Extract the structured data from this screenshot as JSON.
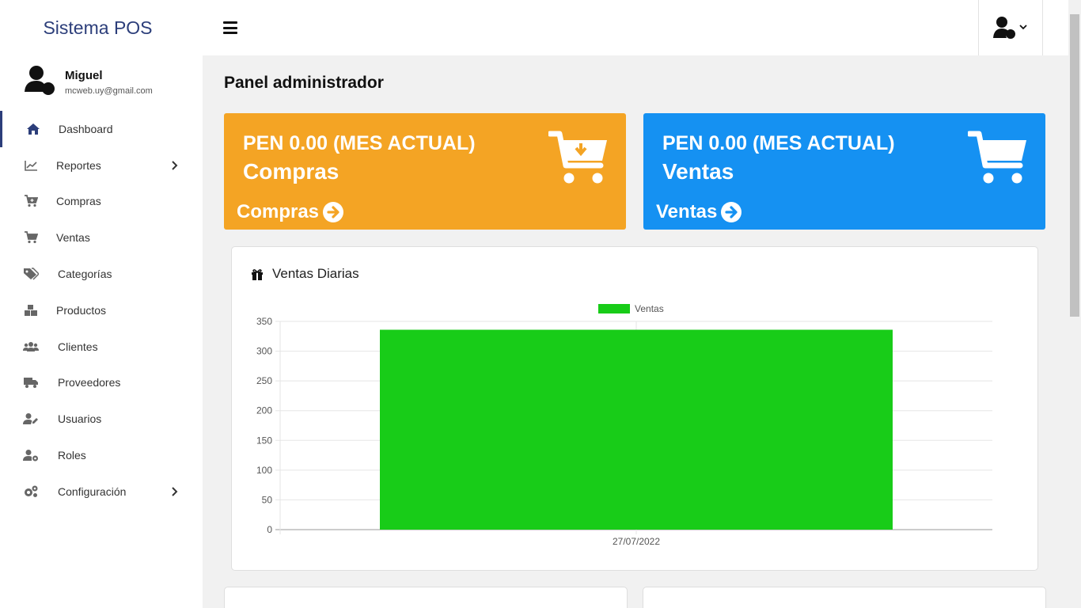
{
  "app": {
    "title": "Sistema POS"
  },
  "user": {
    "name": "Miguel",
    "email": "mcweb.uy@gmail.com"
  },
  "sidebar": {
    "items": [
      {
        "label": "Dashboard",
        "icon": "home-icon"
      },
      {
        "label": "Reportes",
        "icon": "chart-line-icon"
      },
      {
        "label": "Compras",
        "icon": "cart-plus-icon"
      },
      {
        "label": "Ventas",
        "icon": "cart-icon"
      },
      {
        "label": "Categorías",
        "icon": "tags-icon"
      },
      {
        "label": "Productos",
        "icon": "boxes-icon"
      },
      {
        "label": "Clientes",
        "icon": "users-icon"
      },
      {
        "label": "Proveedores",
        "icon": "truck-icon"
      },
      {
        "label": "Usuarios",
        "icon": "user-edit-icon"
      },
      {
        "label": "Roles",
        "icon": "user-cog-icon"
      },
      {
        "label": "Configuración",
        "icon": "cogs-icon"
      }
    ]
  },
  "main": {
    "page_title": "Panel administrador",
    "cards": [
      {
        "amount": "PEN 0.00 (MES ACTUAL)",
        "title": "Compras",
        "link": "Compras",
        "color": "#f4a424"
      },
      {
        "amount": "PEN 0.00 (MES ACTUAL)",
        "title": "Ventas",
        "link": "Ventas",
        "color": "#1591f2"
      }
    ],
    "chart_title": "Ventas Diarias"
  },
  "chart_data": {
    "type": "bar",
    "categories": [
      "27/07/2022"
    ],
    "series": [
      {
        "name": "Ventas",
        "values": [
          336
        ],
        "color": "#18cc18"
      }
    ],
    "ylim": [
      0,
      350
    ],
    "yticks": [
      "0",
      "50",
      "100",
      "150",
      "200",
      "250",
      "300",
      "350"
    ],
    "legend": "top-center",
    "grid": true
  }
}
